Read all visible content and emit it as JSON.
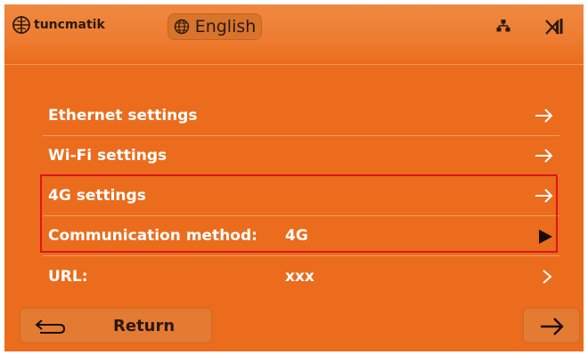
{
  "header": {
    "brand": "tuncmatik",
    "language_label": "English",
    "icons": [
      "globe-icon",
      "network-icon",
      "no-signal-icon"
    ]
  },
  "menu": {
    "ethernet": {
      "label": "Ethernet settings"
    },
    "wifi": {
      "label": "Wi-Fi settings"
    },
    "fourg": {
      "label": "4G settings"
    },
    "comm": {
      "label": "Communication method:",
      "value": "4G"
    },
    "url": {
      "label": "URL:",
      "value": "xxx"
    }
  },
  "footer": {
    "return_label": "Return"
  },
  "colors": {
    "background": "#ea6c1c",
    "text": "#ffffff",
    "highlight_border": "#e0141a"
  }
}
